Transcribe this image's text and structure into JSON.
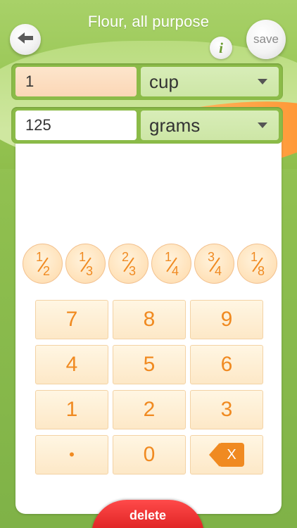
{
  "header": {
    "title": "Flour, all purpose",
    "back_icon": "arrow-left-icon",
    "info_label": "i",
    "save_label": "save"
  },
  "conversion": {
    "from": {
      "quantity": "1",
      "unit": "cup"
    },
    "to": {
      "quantity": "125",
      "unit": "grams"
    }
  },
  "fractions": [
    {
      "num": "1",
      "den": "2"
    },
    {
      "num": "1",
      "den": "3"
    },
    {
      "num": "2",
      "den": "3"
    },
    {
      "num": "1",
      "den": "4"
    },
    {
      "num": "3",
      "den": "4"
    },
    {
      "num": "1",
      "den": "8"
    }
  ],
  "keypad": {
    "keys": [
      "7",
      "8",
      "9",
      "4",
      "5",
      "6",
      "1",
      "2",
      "3",
      "•",
      "0"
    ],
    "backspace_label": "X"
  },
  "footer": {
    "delete_label": "delete"
  },
  "colors": {
    "accent": "#f08a21",
    "brand_green": "#8bbb48",
    "delete_red": "#e02424"
  }
}
